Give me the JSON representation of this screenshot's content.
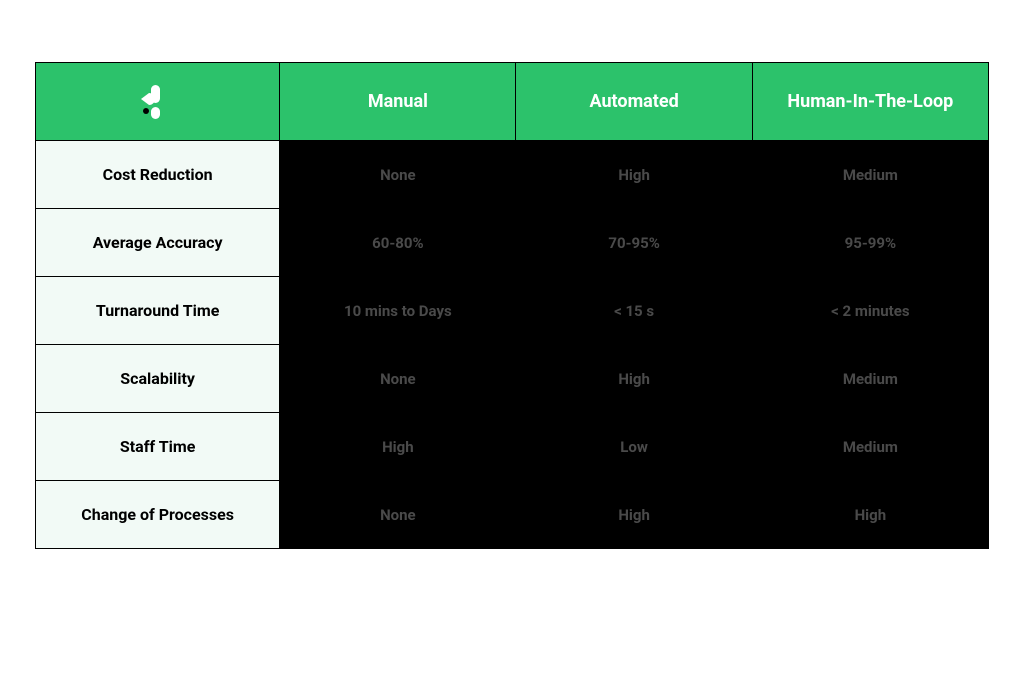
{
  "chart_data": {
    "type": "table",
    "title": "",
    "columns": [
      "Manual",
      "Automated",
      "Human-In-The-Loop"
    ],
    "rows": [
      {
        "feature": "Cost Reduction",
        "values": [
          "None",
          "High",
          "Medium"
        ]
      },
      {
        "feature": "Average Accuracy",
        "values": [
          "60-80%",
          "70-95%",
          "95-99%"
        ]
      },
      {
        "feature": "Turnaround Time",
        "values": [
          "10 mins to Days",
          "< 15 s",
          "< 2 minutes"
        ]
      },
      {
        "feature": "Scalability",
        "values": [
          "None",
          "High",
          "Medium"
        ]
      },
      {
        "feature": "Staff Time",
        "values": [
          "High",
          "Low",
          "Medium"
        ]
      },
      {
        "feature": "Change of Processes",
        "values": [
          "None",
          "High",
          "High"
        ]
      }
    ]
  },
  "colors": {
    "header_bg": "#2CC26B",
    "header_text": "#FFFFFF",
    "feature_bg": "#F2FAF6",
    "feature_text": "#000000",
    "data_bg": "#000000",
    "data_text": "#4A4A4A",
    "border": "#000000"
  },
  "logo": {
    "name": "k-logo"
  }
}
